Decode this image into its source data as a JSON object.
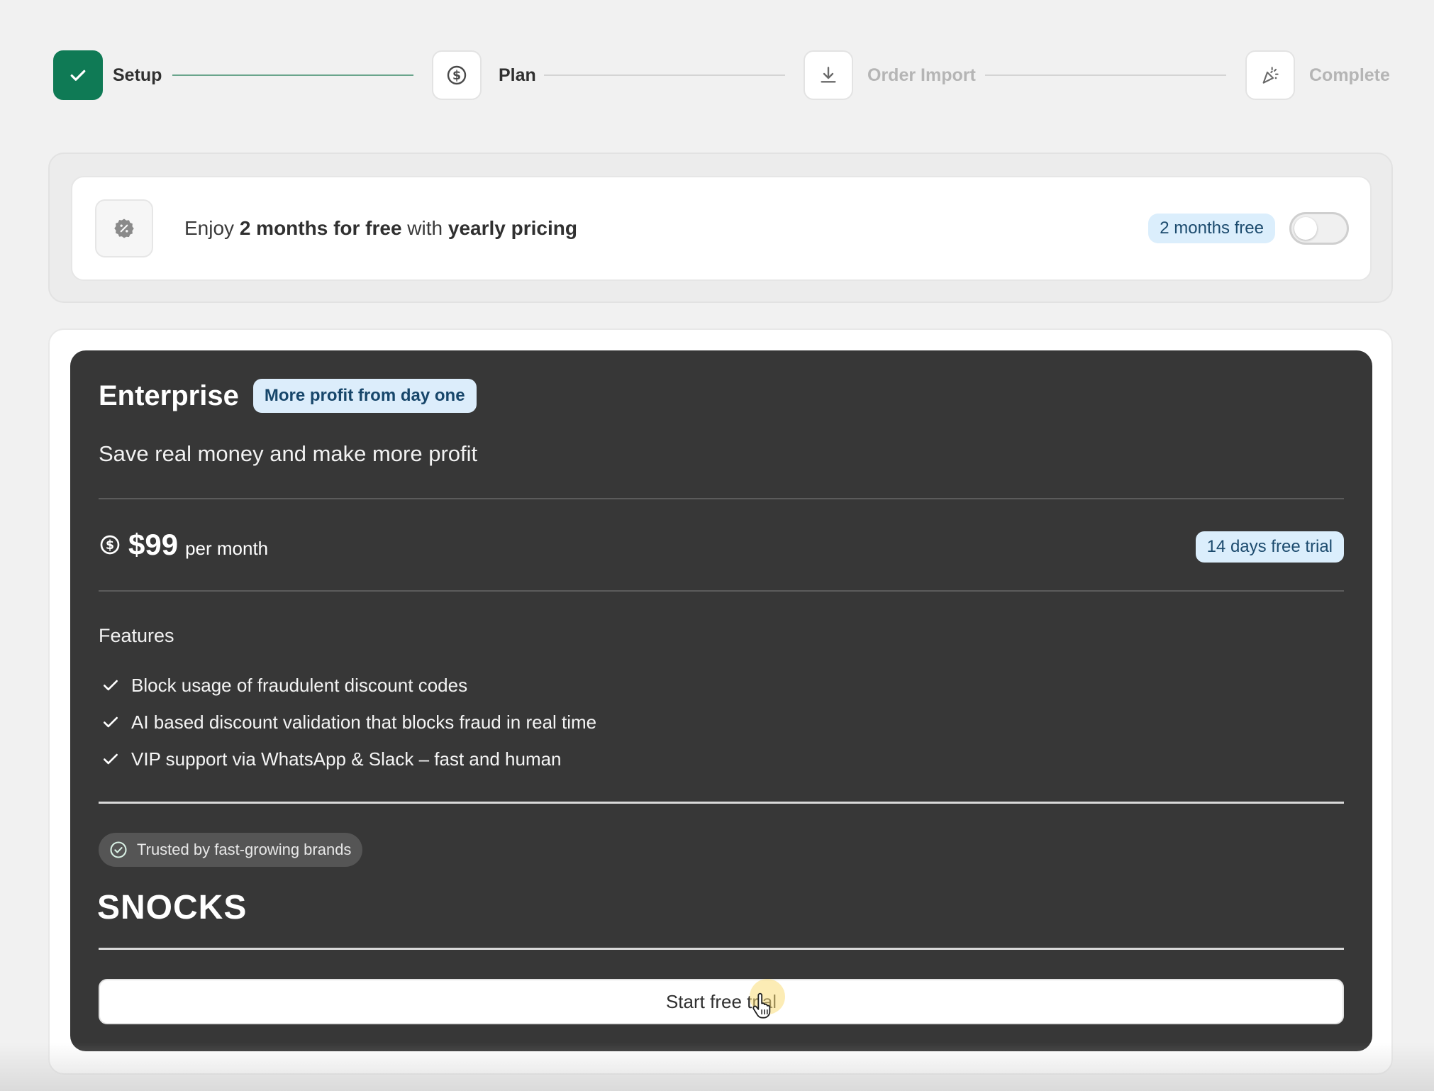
{
  "stepper": {
    "steps": [
      {
        "label": "Setup",
        "state": "done",
        "icon": "check-icon"
      },
      {
        "label": "Plan",
        "state": "active",
        "icon": "dollar-coin-icon"
      },
      {
        "label": "Order Import",
        "state": "upcoming",
        "icon": "download-icon"
      },
      {
        "label": "Complete",
        "state": "upcoming",
        "icon": "confetti-icon"
      }
    ]
  },
  "promo": {
    "text_pre": "Enjoy ",
    "text_bold1": "2 months for free",
    "text_mid": " with ",
    "text_bold2": "yearly pricing",
    "badge": "2 months free",
    "toggle_on": false,
    "icon": "gear-badge-icon"
  },
  "plan": {
    "name": "Enterprise",
    "badge": "More profit from day one",
    "subtitle": "Save real money and make more profit",
    "price": "$99",
    "period": "per month",
    "trial_badge": "14 days free trial",
    "features_title": "Features",
    "features": [
      "Block usage of fraudulent discount codes",
      "AI based discount validation that blocks fraud in real time",
      "VIP support via WhatsApp & Slack – fast and human"
    ],
    "trusted": "Trusted by fast-growing brands",
    "brand": "SNOCKS",
    "cta": "Start free trial"
  },
  "colors": {
    "accent": "#0f7a55",
    "card_dark": "#373737",
    "badge_bg": "#dbeefc",
    "badge_text": "#1c4b6e",
    "page_bg": "#f1f1f1"
  }
}
